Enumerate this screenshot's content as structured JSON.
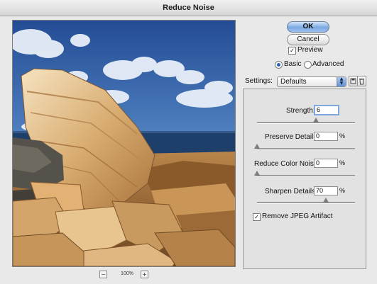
{
  "window": {
    "title": "Reduce Noise"
  },
  "preview": {
    "zoom_level": "100%",
    "zoom_out": "−",
    "zoom_in": "+"
  },
  "buttons": {
    "ok": "OK",
    "cancel": "Cancel"
  },
  "preview_toggle": {
    "label": "Preview",
    "checked": true
  },
  "mode": {
    "basic": "Basic",
    "advanced": "Advanced",
    "selected": "Basic"
  },
  "settings": {
    "label": "Settings:",
    "value": "Defaults"
  },
  "controls": {
    "strength": {
      "label": "Strength:",
      "value": "6",
      "unit": "",
      "max": 10
    },
    "preserve_details": {
      "label": "Preserve Details:",
      "value": "0",
      "unit": "%",
      "max": 100
    },
    "reduce_color_noise": {
      "label": "Reduce Color Noise:",
      "value": "0",
      "unit": "%",
      "max": 100
    },
    "sharpen_details": {
      "label": "Sharpen Details:",
      "value": "70",
      "unit": "%",
      "max": 100
    }
  },
  "remove_jpeg_artifact": {
    "label": "Remove JPEG Artifact",
    "checked": true
  },
  "colors": {
    "ok_button": "#7aa8e2",
    "window_bg": "#e9e9e9"
  },
  "icons": {
    "save_settings": "disk-icon",
    "delete_settings": "trash-icon"
  }
}
